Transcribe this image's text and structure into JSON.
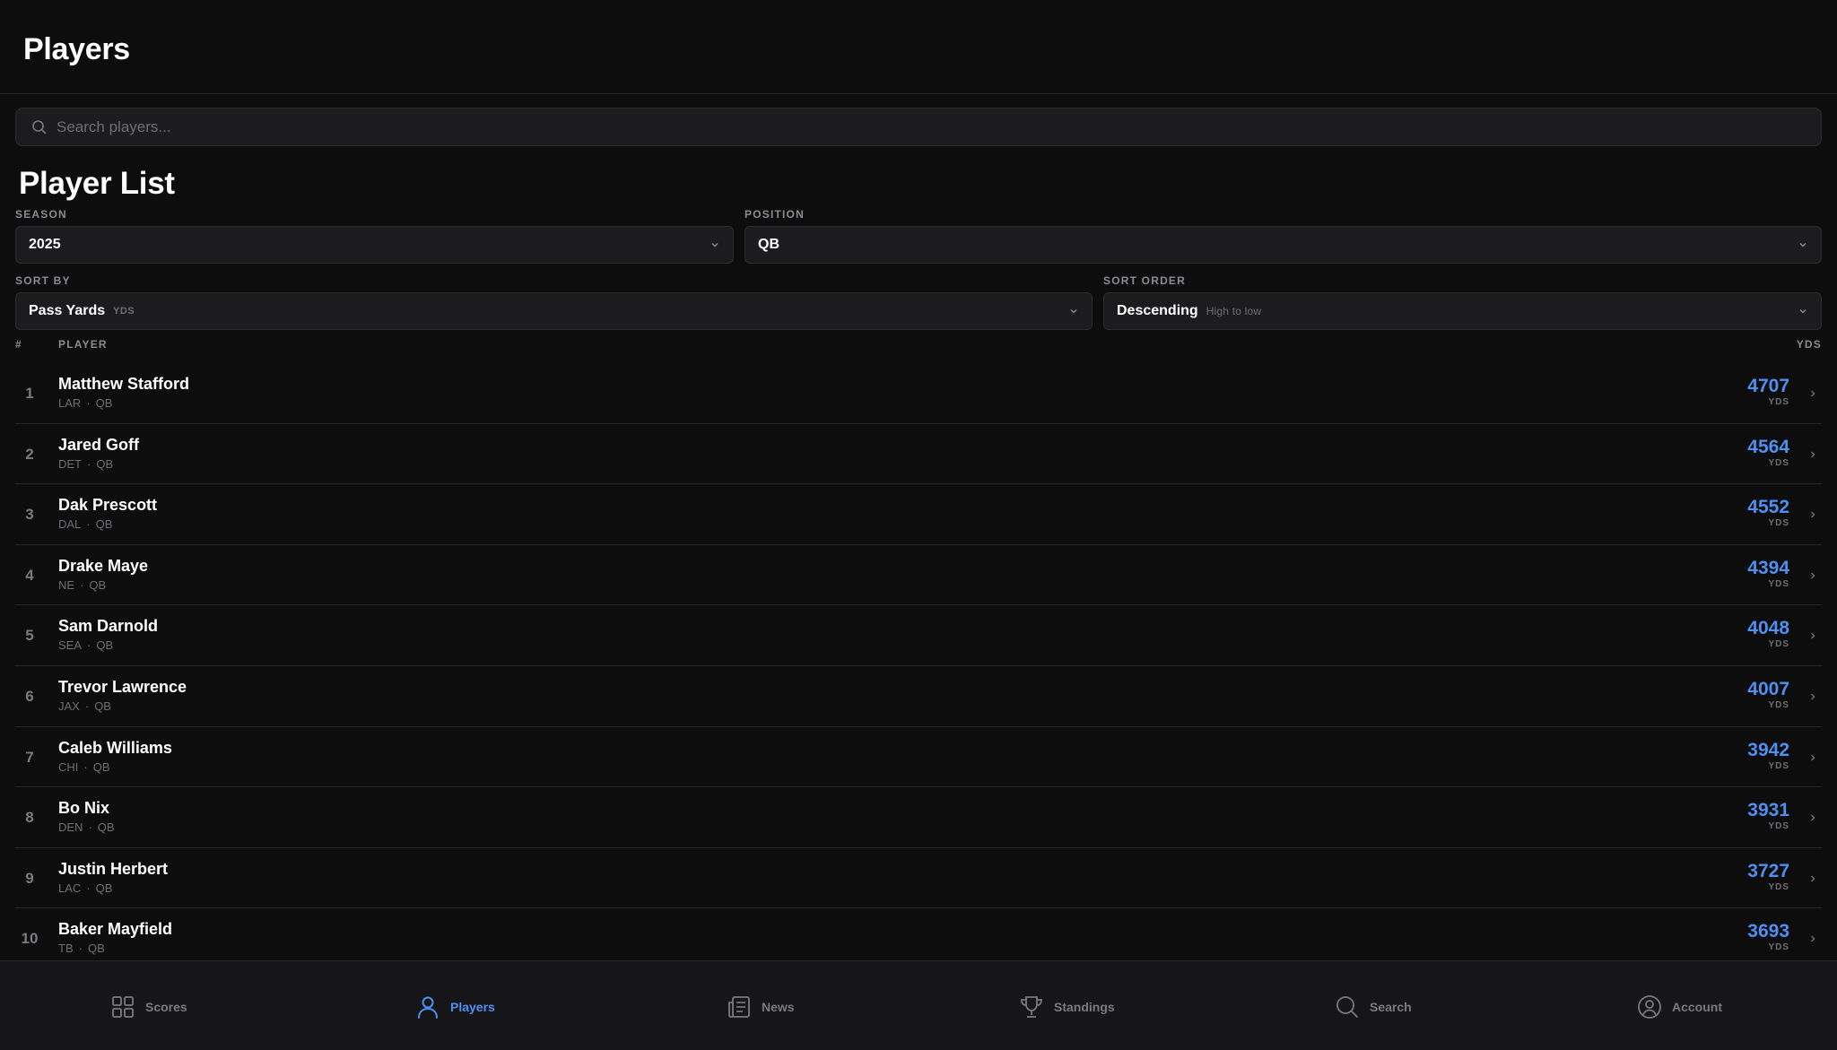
{
  "header": {
    "title": "Players"
  },
  "search": {
    "placeholder": "Search players..."
  },
  "section": {
    "title": "Player List"
  },
  "filters": {
    "season": {
      "label": "SEASON",
      "value": "2025"
    },
    "position": {
      "label": "POSITION",
      "value": "QB"
    },
    "sort_by": {
      "label": "SORT BY",
      "value": "Pass Yards",
      "hint": "YDS"
    },
    "sort_order": {
      "label": "SORT ORDER",
      "value": "Descending",
      "hint": "High to low"
    }
  },
  "table": {
    "headers": {
      "rank": "#",
      "player": "PLAYER",
      "stat": "YDS"
    },
    "rows": [
      {
        "rank": "1",
        "name": "Matthew Stafford",
        "team": "LAR",
        "pos": "QB",
        "value": "4707",
        "unit": "YDS"
      },
      {
        "rank": "2",
        "name": "Jared Goff",
        "team": "DET",
        "pos": "QB",
        "value": "4564",
        "unit": "YDS"
      },
      {
        "rank": "3",
        "name": "Dak Prescott",
        "team": "DAL",
        "pos": "QB",
        "value": "4552",
        "unit": "YDS"
      },
      {
        "rank": "4",
        "name": "Drake Maye",
        "team": "NE",
        "pos": "QB",
        "value": "4394",
        "unit": "YDS"
      },
      {
        "rank": "5",
        "name": "Sam Darnold",
        "team": "SEA",
        "pos": "QB",
        "value": "4048",
        "unit": "YDS"
      },
      {
        "rank": "6",
        "name": "Trevor Lawrence",
        "team": "JAX",
        "pos": "QB",
        "value": "4007",
        "unit": "YDS"
      },
      {
        "rank": "7",
        "name": "Caleb Williams",
        "team": "CHI",
        "pos": "QB",
        "value": "3942",
        "unit": "YDS"
      },
      {
        "rank": "8",
        "name": "Bo Nix",
        "team": "DEN",
        "pos": "QB",
        "value": "3931",
        "unit": "YDS"
      },
      {
        "rank": "9",
        "name": "Justin Herbert",
        "team": "LAC",
        "pos": "QB",
        "value": "3727",
        "unit": "YDS"
      },
      {
        "rank": "10",
        "name": "Baker Mayfield",
        "team": "TB",
        "pos": "QB",
        "value": "3693",
        "unit": "YDS"
      }
    ]
  },
  "nav": {
    "items": [
      {
        "label": "Scores",
        "icon": "grid-icon",
        "active": false
      },
      {
        "label": "Players",
        "icon": "person-icon",
        "active": true
      },
      {
        "label": "News",
        "icon": "newspaper-icon",
        "active": false
      },
      {
        "label": "Standings",
        "icon": "trophy-icon",
        "active": false
      },
      {
        "label": "Search",
        "icon": "search-icon",
        "active": false
      },
      {
        "label": "Account",
        "icon": "account-icon",
        "active": false
      }
    ]
  },
  "colors": {
    "background": "#0d0d0e",
    "accent": "#4f8ff0",
    "muted": "#6e6e74"
  }
}
